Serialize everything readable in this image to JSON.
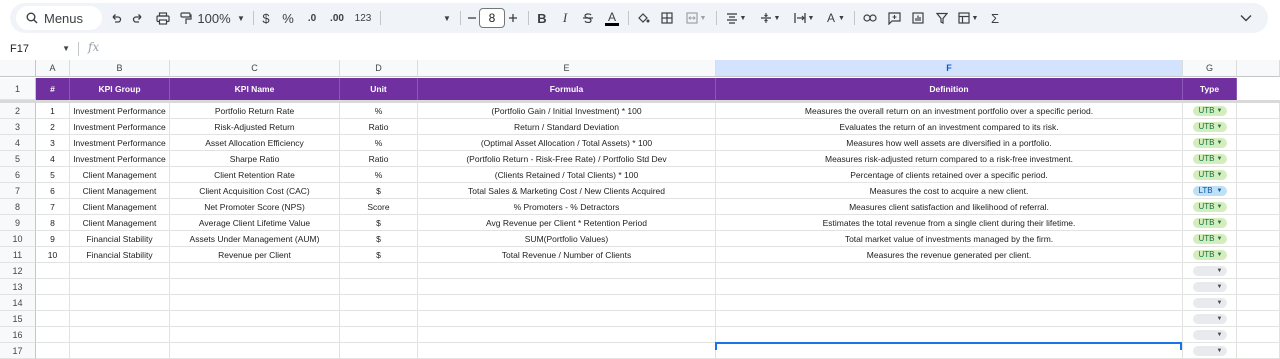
{
  "toolbar": {
    "menus_label": "Menus",
    "zoom": "100%",
    "currency": "$",
    "percent": "%",
    "decrease_decimal": ".0",
    "increase_decimal": ".00",
    "number_format": "123",
    "font_size": "8",
    "bold": "B",
    "italic": "I",
    "text_color": "A",
    "rotate": "A",
    "function": "Σ",
    "icons": [
      "search-icon",
      "undo-icon",
      "redo-icon",
      "print-icon",
      "paint-format-icon",
      "font-family-dropdown",
      "minus-icon",
      "plus-icon",
      "strikethrough-icon",
      "fill-color-icon",
      "borders-icon",
      "merge-cells-icon",
      "halign-icon",
      "valign-icon",
      "wrap-icon",
      "link-icon",
      "comment-icon",
      "chart-icon",
      "filter-icon",
      "table-view-icon",
      "function-icon",
      "collapse-icon"
    ]
  },
  "formula_bar": {
    "cell_ref": "F17",
    "fx": "fx",
    "value": ""
  },
  "columns": [
    {
      "letter": "A"
    },
    {
      "letter": "B"
    },
    {
      "letter": "C"
    },
    {
      "letter": "D"
    },
    {
      "letter": "E"
    },
    {
      "letter": "F",
      "selected": true
    },
    {
      "letter": "G"
    }
  ],
  "header_row": {
    "row_number": "1",
    "cells": [
      "#",
      "KPI Group",
      "KPI Name",
      "Unit",
      "Formula",
      "Definition",
      "Type"
    ]
  },
  "rows": [
    {
      "n": "2",
      "num": "1",
      "group": "Investment Performance",
      "name": "Portfolio Return Rate",
      "unit": "%",
      "formula": "(Portfolio Gain / Initial Investment) * 100",
      "definition": "Measures the overall return on an investment portfolio over a specific period.",
      "type": "UTB"
    },
    {
      "n": "3",
      "num": "2",
      "group": "Investment Performance",
      "name": "Risk-Adjusted Return",
      "unit": "Ratio",
      "formula": "Return / Standard Deviation",
      "definition": "Evaluates the return of an investment compared to its risk.",
      "type": "UTB"
    },
    {
      "n": "4",
      "num": "3",
      "group": "Investment Performance",
      "name": "Asset Allocation Efficiency",
      "unit": "%",
      "formula": "(Optimal Asset Allocation / Total Assets) * 100",
      "definition": "Measures how well assets are diversified in a portfolio.",
      "type": "UTB"
    },
    {
      "n": "5",
      "num": "4",
      "group": "Investment Performance",
      "name": "Sharpe Ratio",
      "unit": "Ratio",
      "formula": "(Portfolio Return - Risk-Free Rate) / Portfolio Std Dev",
      "definition": "Measures risk-adjusted return compared to a risk-free investment.",
      "type": "UTB"
    },
    {
      "n": "6",
      "num": "5",
      "group": "Client Management",
      "name": "Client Retention Rate",
      "unit": "%",
      "formula": "(Clients Retained / Total Clients) * 100",
      "definition": "Percentage of clients retained over a specific period.",
      "type": "UTB"
    },
    {
      "n": "7",
      "num": "6",
      "group": "Client Management",
      "name": "Client Acquisition Cost (CAC)",
      "unit": "$",
      "formula": "Total Sales & Marketing Cost / New Clients Acquired",
      "definition": "Measures the cost to acquire a new client.",
      "type": "LTB"
    },
    {
      "n": "8",
      "num": "7",
      "group": "Client Management",
      "name": "Net Promoter Score (NPS)",
      "unit": "Score",
      "formula": "% Promoters - % Detractors",
      "definition": "Measures client satisfaction and likelihood of referral.",
      "type": "UTB"
    },
    {
      "n": "9",
      "num": "8",
      "group": "Client Management",
      "name": "Average Client Lifetime Value",
      "unit": "$",
      "formula": "Avg Revenue per Client * Retention Period",
      "definition": "Estimates the total revenue from a single client during their lifetime.",
      "type": "UTB"
    },
    {
      "n": "10",
      "num": "9",
      "group": "Financial Stability",
      "name": "Assets Under Management (AUM)",
      "unit": "$",
      "formula": "SUM(Portfolio Values)",
      "definition": "Total market value of investments managed by the firm.",
      "type": "UTB"
    },
    {
      "n": "11",
      "num": "10",
      "group": "Financial Stability",
      "name": "Revenue per Client",
      "unit": "$",
      "formula": "Total Revenue / Number of Clients",
      "definition": "Measures the revenue generated per client.",
      "type": "UTB"
    },
    {
      "n": "12",
      "num": "",
      "group": "",
      "name": "",
      "unit": "",
      "formula": "",
      "definition": "",
      "type": ""
    },
    {
      "n": "13",
      "num": "",
      "group": "",
      "name": "",
      "unit": "",
      "formula": "",
      "definition": "",
      "type": ""
    },
    {
      "n": "14",
      "num": "",
      "group": "",
      "name": "",
      "unit": "",
      "formula": "",
      "definition": "",
      "type": ""
    },
    {
      "n": "15",
      "num": "",
      "group": "",
      "name": "",
      "unit": "",
      "formula": "",
      "definition": "",
      "type": ""
    },
    {
      "n": "16",
      "num": "",
      "group": "",
      "name": "",
      "unit": "",
      "formula": "",
      "definition": "",
      "type": ""
    },
    {
      "n": "17",
      "num": "",
      "group": "",
      "name": "",
      "unit": "",
      "formula": "",
      "definition": "",
      "type": ""
    }
  ],
  "colors": {
    "header_fill": "#7030a0",
    "utb_chip": "#d4edbc",
    "utb_text": "#11734b",
    "ltb_chip": "#bfe1f6",
    "ltb_text": "#0a53a8",
    "empty_chip": "#e8eaed",
    "selection": "#1a73e8"
  }
}
